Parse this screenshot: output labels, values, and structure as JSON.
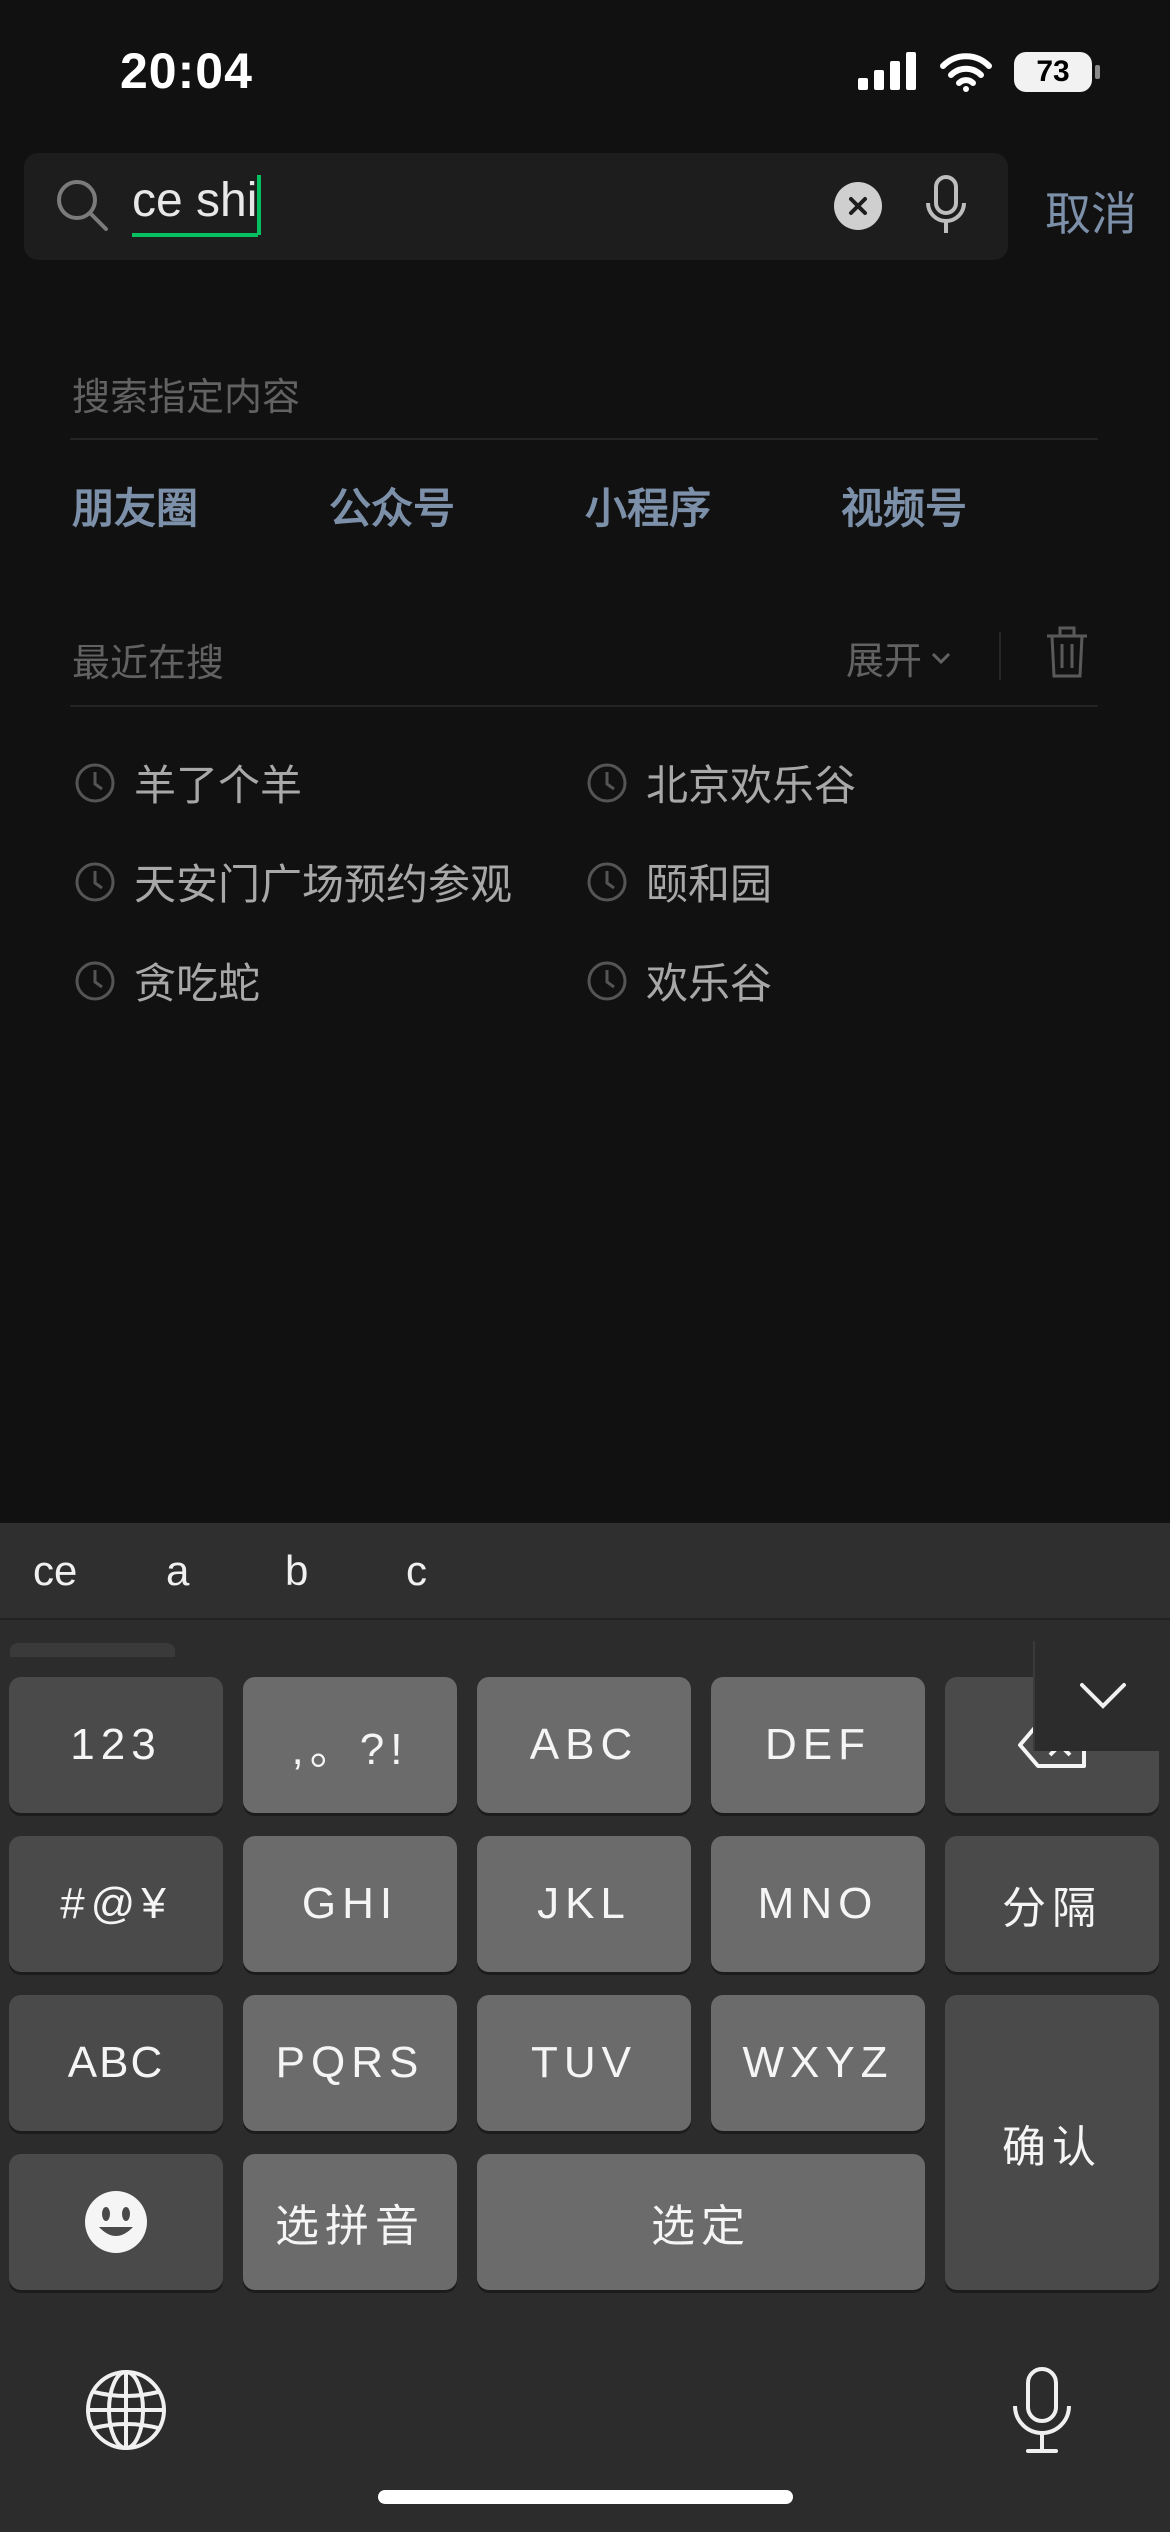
{
  "status_bar": {
    "time": "20:04",
    "battery": "73"
  },
  "search": {
    "query": "ce shi",
    "cancel_label": "取消"
  },
  "specified": {
    "label": "搜索指定内容",
    "categories": [
      "朋友圈",
      "公众号",
      "小程序",
      "视频号"
    ]
  },
  "recent": {
    "label": "最近在搜",
    "expand_label": "展开",
    "items": [
      "羊了个羊",
      "北京欢乐谷",
      "天安门广场预约参观",
      "颐和园",
      "贪吃蛇",
      "欢乐谷"
    ]
  },
  "keyboard": {
    "candidates": [
      "ce",
      "a",
      "b",
      "c"
    ],
    "keys": {
      "num": "123",
      "punct": ",。?!",
      "abc": "ABC",
      "def": "DEF",
      "symbols": "#@¥",
      "ghi": "GHI",
      "jkl": "JKL",
      "mno": "MNO",
      "separator": "分隔",
      "abc_mode": "ABC",
      "pqrs": "PQRS",
      "tuv": "TUV",
      "wxyz": "WXYZ",
      "confirm": "确认",
      "choose_pinyin": "选拼音",
      "select": "选定"
    }
  },
  "icons": [
    "search-icon",
    "clear-icon",
    "microphone-icon",
    "chevron-down-icon",
    "trash-icon",
    "clock-icon",
    "backspace-icon",
    "emoji-icon",
    "globe-icon",
    "cellular-signal-icon",
    "wifi-icon"
  ]
}
